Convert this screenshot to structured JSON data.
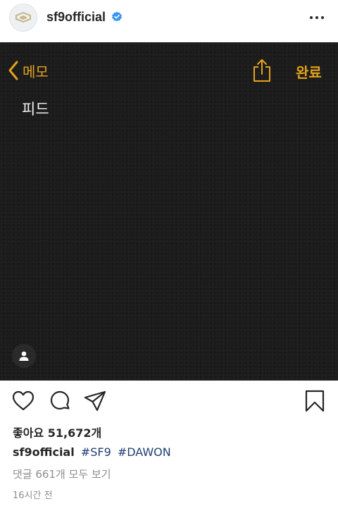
{
  "header": {
    "username": "sf9official",
    "verified": true,
    "avatar_icon": "sf9-logo-icon",
    "more_icon": "more-options-icon"
  },
  "post_image": {
    "notes_app": {
      "back_label": "메모",
      "done_label": "완료",
      "share_icon": "share-icon",
      "body_text": "피드",
      "person_icon": "person-icon",
      "accent_color": "#e3a21a"
    }
  },
  "actions": {
    "like_icon": "heart-icon",
    "comment_icon": "comment-icon",
    "share_icon": "paper-plane-icon",
    "save_icon": "bookmark-icon"
  },
  "likes_text": "좋아요 51,672개",
  "caption": {
    "username": "sf9official",
    "tags": [
      "#SF9",
      "#DAWON"
    ]
  },
  "comments_link": "댓글 661개 모두 보기",
  "timestamp": "16시간 전",
  "colors": {
    "text": "#262626",
    "muted": "#8e8e8e",
    "hashtag": "#1e3f73",
    "verified": "#3897f0"
  }
}
